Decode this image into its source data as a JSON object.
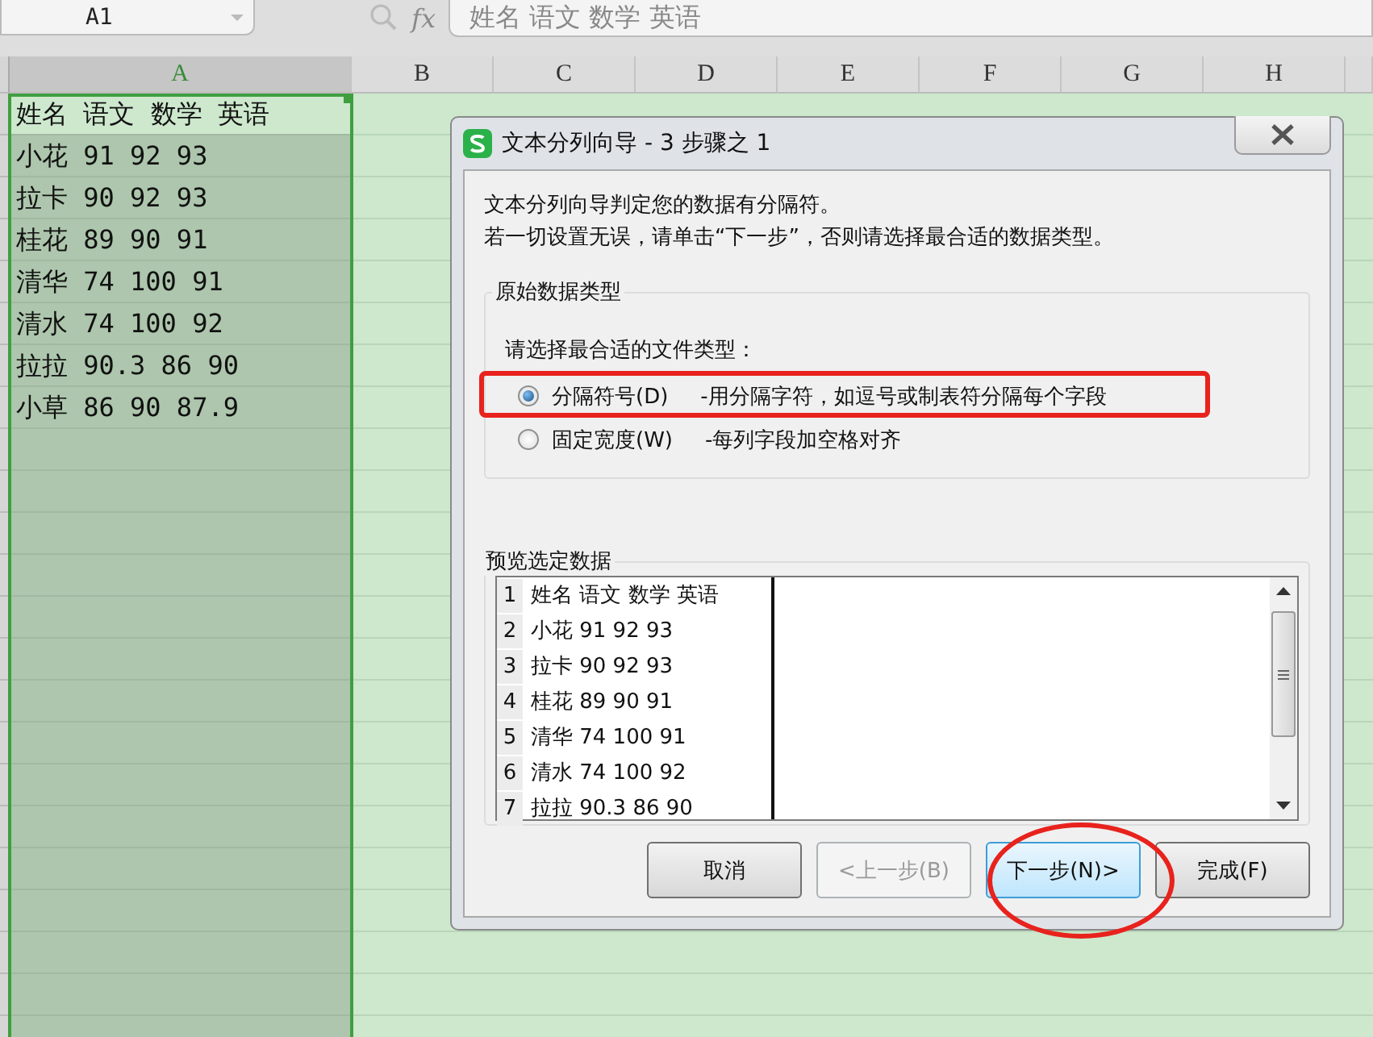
{
  "name_box": {
    "value": "A1"
  },
  "formula_bar": {
    "function_label": "fx",
    "value": "姓名 语文 数学 英语"
  },
  "columns": [
    {
      "label": "A",
      "selected": true
    },
    {
      "label": "B",
      "selected": false
    },
    {
      "label": "C",
      "selected": false
    },
    {
      "label": "D",
      "selected": false
    },
    {
      "label": "E",
      "selected": false
    },
    {
      "label": "F",
      "selected": false
    },
    {
      "label": "G",
      "selected": false
    },
    {
      "label": "H",
      "selected": false
    }
  ],
  "cells": [
    "姓名 语文 数学 英语",
    "小花 91 92 93",
    "拉卡 90 92 93",
    "桂花 89 90 91",
    "清华 74 100 91",
    "清水 74 100 92",
    "拉拉 90.3 86 90",
    "小草 86 90 87.9"
  ],
  "dialog": {
    "title": "文本分列向导 - 3 步骤之 1",
    "intro": [
      "文本分列向导判定您的数据有分隔符。",
      "若一切设置无误，请单击“下一步”，否则请选择最合适的数据类型。"
    ],
    "group_title": "原始数据类型",
    "prompt": "请选择最合适的文件类型：",
    "options": [
      {
        "label": "分隔符号(D)",
        "description": "-用分隔字符，如逗号或制表符分隔每个字段",
        "selected": true
      },
      {
        "label": "固定宽度(W)",
        "description": "-每列字段加空格对齐",
        "selected": false
      }
    ],
    "preview": {
      "title": "预览选定数据",
      "rows": [
        {
          "number": "1",
          "text": "姓名 语文 数学 英语"
        },
        {
          "number": "2",
          "text": "小花 91 92 93"
        },
        {
          "number": "3",
          "text": "拉卡 90 92 93"
        },
        {
          "number": "4",
          "text": "桂花 89 90 91"
        },
        {
          "number": "5",
          "text": "清华 74 100 91"
        },
        {
          "number": "6",
          "text": "清水 74 100 92"
        },
        {
          "number": "7",
          "text": "拉拉 90.3 86 90"
        }
      ]
    },
    "buttons": [
      {
        "label": "取消",
        "disabled": false,
        "default": false
      },
      {
        "label": "<上一步(B)",
        "disabled": true,
        "default": false
      },
      {
        "label": "下一步(N)>",
        "disabled": false,
        "default": true
      },
      {
        "label": "完成(F)",
        "disabled": false,
        "default": false
      }
    ]
  }
}
